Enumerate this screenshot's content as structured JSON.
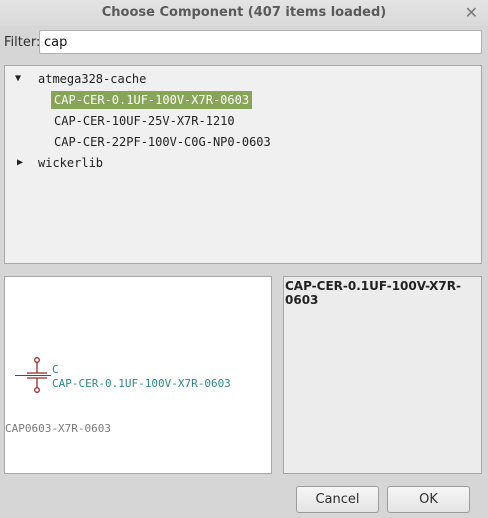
{
  "window": {
    "title": "Choose Component (407 items loaded)",
    "close_glyph": "✕"
  },
  "filter": {
    "label": "Filter:",
    "value": "cap"
  },
  "tree": {
    "libraries": [
      {
        "name": "atmega328-cache",
        "expanded": true,
        "items": [
          "CAP-CER-0.1UF-100V-X7R-0603",
          "CAP-CER-10UF-25V-X7R-1210",
          "CAP-CER-22PF-100V-C0G-NP0-0603"
        ],
        "selected_index": 0
      },
      {
        "name": "wickerlib",
        "expanded": false,
        "items": []
      }
    ]
  },
  "preview": {
    "reference": "C",
    "value": "CAP-CER-0.1UF-100V-X7R-0603",
    "overlap_text": "CAP0603-X7R-0603",
    "colors": {
      "symbol": "#9c2a2a",
      "text": "#2c8a8a",
      "overlap": "#7a7a7a"
    }
  },
  "info": {
    "text": "CAP-CER-0.1UF-100V-X7R-0603"
  },
  "buttons": {
    "cancel": "Cancel",
    "ok": "OK"
  },
  "colors": {
    "selection": "#87a556",
    "window_bg": "#d6d6d6"
  }
}
